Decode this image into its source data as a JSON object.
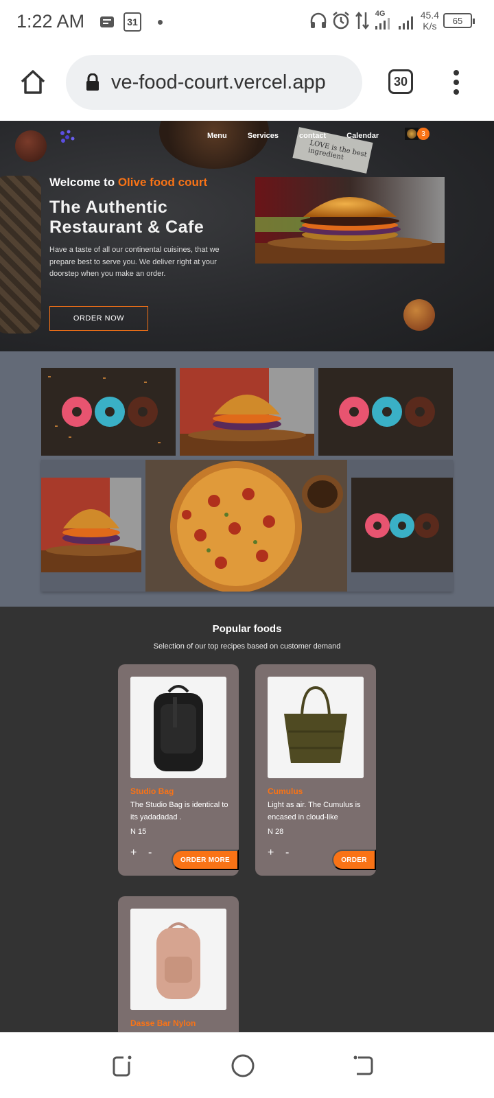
{
  "status_bar": {
    "time": "1:22 AM",
    "calendar_day": "31",
    "network": "4G",
    "speed_value": "45.4",
    "speed_unit": "K/s",
    "battery": "65"
  },
  "browser": {
    "url": "ve-food-court.vercel.app",
    "tab_count": "30"
  },
  "nav": {
    "items": [
      "Menu",
      "Services",
      "contact",
      "Calendar"
    ],
    "cart_count": "3"
  },
  "hero": {
    "welcome_prefix": "Welcome to",
    "brand": "Olive food court",
    "title": "The Authentic Restaurant & Cafe",
    "description": "Have a taste of all our continental cuisines, that we prepare best to serve you. We deliver right at your doorstep when you make an order.",
    "cta": "ORDER NOW",
    "newspaper_text": "LOVE is the best ingredient"
  },
  "popular": {
    "title": "Popular foods",
    "subtitle": "Selection of our top recipes based on customer demand",
    "items": [
      {
        "name": "Studio Bag",
        "description": "The Studio Bag is identical to its yadadadad .",
        "price": "N 15",
        "button": "ORDER MORE",
        "plus": "+",
        "minus": "-"
      },
      {
        "name": "Cumulus",
        "description": "Light as air. The Cumulus is encased in cloud-like",
        "price": "N 28",
        "button": "ORDER",
        "plus": "+",
        "minus": "-"
      },
      {
        "name": "Dasse Bar Nylon"
      }
    ]
  },
  "colors": {
    "accent": "#f97316",
    "gallery_bg": "#636a77",
    "popular_bg": "#333333",
    "card_bg": "#7b6e6e"
  }
}
